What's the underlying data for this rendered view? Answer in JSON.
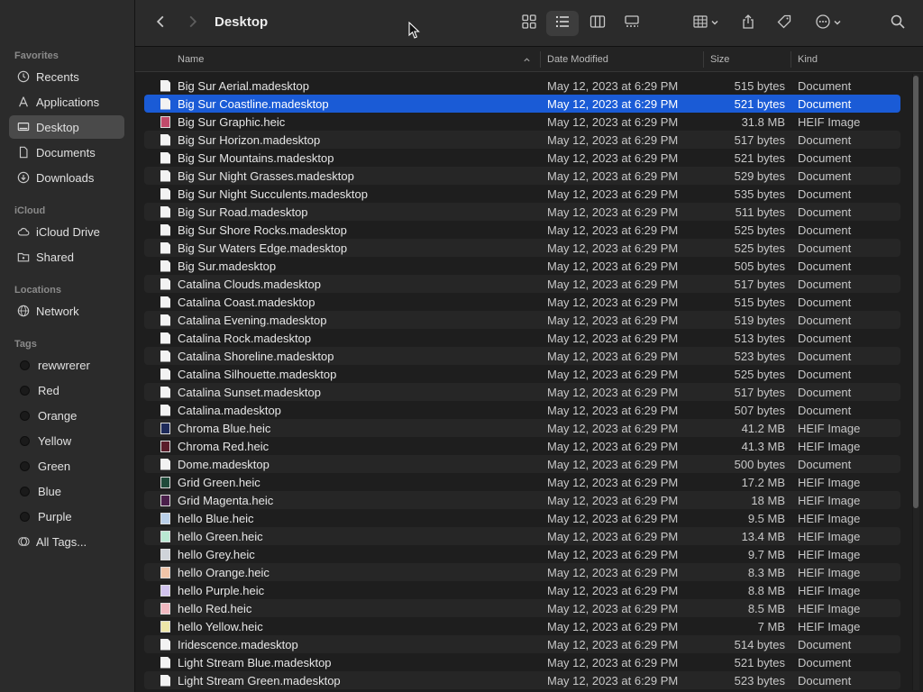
{
  "window": {
    "title": "Desktop"
  },
  "sidebar": {
    "sections": {
      "favorites": "Favorites",
      "icloud": "iCloud",
      "locations": "Locations",
      "tags": "Tags"
    },
    "favorites": [
      {
        "label": "Recents",
        "icon": "clock-icon"
      },
      {
        "label": "Applications",
        "icon": "applications-icon"
      },
      {
        "label": "Desktop",
        "icon": "desktop-icon",
        "active": true
      },
      {
        "label": "Documents",
        "icon": "document-icon"
      },
      {
        "label": "Downloads",
        "icon": "download-icon"
      }
    ],
    "icloud": [
      {
        "label": "iCloud Drive",
        "icon": "cloud-icon"
      },
      {
        "label": "Shared",
        "icon": "shared-folder-icon"
      }
    ],
    "locations": [
      {
        "label": "Network",
        "icon": "globe-icon"
      }
    ],
    "tags": [
      {
        "label": "rewwrerer"
      },
      {
        "label": "Red"
      },
      {
        "label": "Orange"
      },
      {
        "label": "Yellow"
      },
      {
        "label": "Green"
      },
      {
        "label": "Blue"
      },
      {
        "label": "Purple"
      },
      {
        "label": "All Tags...",
        "icon": "all-tags-icon"
      }
    ]
  },
  "columns": {
    "name": "Name",
    "date": "Date Modified",
    "size": "Size",
    "kind": "Kind"
  },
  "files": [
    {
      "name": "Big Sur Aerial.madesktop",
      "date": "May 12, 2023 at 6:29 PM",
      "size": "515 bytes",
      "kind": "Document",
      "type": "doc"
    },
    {
      "name": "Big Sur Coastline.madesktop",
      "date": "May 12, 2023 at 6:29 PM",
      "size": "521 bytes",
      "kind": "Document",
      "type": "doc",
      "selected": true
    },
    {
      "name": "Big Sur Graphic.heic",
      "date": "May 12, 2023 at 6:29 PM",
      "size": "31.8 MB",
      "kind": "HEIF Image",
      "type": "img",
      "thumb": "#c04a6a"
    },
    {
      "name": "Big Sur Horizon.madesktop",
      "date": "May 12, 2023 at 6:29 PM",
      "size": "517 bytes",
      "kind": "Document",
      "type": "doc"
    },
    {
      "name": "Big Sur Mountains.madesktop",
      "date": "May 12, 2023 at 6:29 PM",
      "size": "521 bytes",
      "kind": "Document",
      "type": "doc"
    },
    {
      "name": "Big Sur Night Grasses.madesktop",
      "date": "May 12, 2023 at 6:29 PM",
      "size": "529 bytes",
      "kind": "Document",
      "type": "doc"
    },
    {
      "name": "Big Sur Night Succulents.madesktop",
      "date": "May 12, 2023 at 6:29 PM",
      "size": "535 bytes",
      "kind": "Document",
      "type": "doc"
    },
    {
      "name": "Big Sur Road.madesktop",
      "date": "May 12, 2023 at 6:29 PM",
      "size": "511 bytes",
      "kind": "Document",
      "type": "doc"
    },
    {
      "name": "Big Sur Shore Rocks.madesktop",
      "date": "May 12, 2023 at 6:29 PM",
      "size": "525 bytes",
      "kind": "Document",
      "type": "doc"
    },
    {
      "name": "Big Sur Waters Edge.madesktop",
      "date": "May 12, 2023 at 6:29 PM",
      "size": "525 bytes",
      "kind": "Document",
      "type": "doc"
    },
    {
      "name": "Big Sur.madesktop",
      "date": "May 12, 2023 at 6:29 PM",
      "size": "505 bytes",
      "kind": "Document",
      "type": "doc"
    },
    {
      "name": "Catalina Clouds.madesktop",
      "date": "May 12, 2023 at 6:29 PM",
      "size": "517 bytes",
      "kind": "Document",
      "type": "doc"
    },
    {
      "name": "Catalina Coast.madesktop",
      "date": "May 12, 2023 at 6:29 PM",
      "size": "515 bytes",
      "kind": "Document",
      "type": "doc"
    },
    {
      "name": "Catalina Evening.madesktop",
      "date": "May 12, 2023 at 6:29 PM",
      "size": "519 bytes",
      "kind": "Document",
      "type": "doc"
    },
    {
      "name": "Catalina Rock.madesktop",
      "date": "May 12, 2023 at 6:29 PM",
      "size": "513 bytes",
      "kind": "Document",
      "type": "doc"
    },
    {
      "name": "Catalina Shoreline.madesktop",
      "date": "May 12, 2023 at 6:29 PM",
      "size": "523 bytes",
      "kind": "Document",
      "type": "doc"
    },
    {
      "name": "Catalina Silhouette.madesktop",
      "date": "May 12, 2023 at 6:29 PM",
      "size": "525 bytes",
      "kind": "Document",
      "type": "doc"
    },
    {
      "name": "Catalina Sunset.madesktop",
      "date": "May 12, 2023 at 6:29 PM",
      "size": "517 bytes",
      "kind": "Document",
      "type": "doc"
    },
    {
      "name": "Catalina.madesktop",
      "date": "May 12, 2023 at 6:29 PM",
      "size": "507 bytes",
      "kind": "Document",
      "type": "doc"
    },
    {
      "name": "Chroma Blue.heic",
      "date": "May 12, 2023 at 6:29 PM",
      "size": "41.2 MB",
      "kind": "HEIF Image",
      "type": "img",
      "thumb": "#1d2a5a"
    },
    {
      "name": "Chroma Red.heic",
      "date": "May 12, 2023 at 6:29 PM",
      "size": "41.3 MB",
      "kind": "HEIF Image",
      "type": "img",
      "thumb": "#5a1d2a"
    },
    {
      "name": "Dome.madesktop",
      "date": "May 12, 2023 at 6:29 PM",
      "size": "500 bytes",
      "kind": "Document",
      "type": "doc"
    },
    {
      "name": "Grid Green.heic",
      "date": "May 12, 2023 at 6:29 PM",
      "size": "17.2 MB",
      "kind": "HEIF Image",
      "type": "img",
      "thumb": "#1f4a3a"
    },
    {
      "name": "Grid Magenta.heic",
      "date": "May 12, 2023 at 6:29 PM",
      "size": "18 MB",
      "kind": "HEIF Image",
      "type": "img",
      "thumb": "#4a1f4a"
    },
    {
      "name": "hello Blue.heic",
      "date": "May 12, 2023 at 6:29 PM",
      "size": "9.5 MB",
      "kind": "HEIF Image",
      "type": "img",
      "thumb": "#b9cfe8"
    },
    {
      "name": "hello Green.heic",
      "date": "May 12, 2023 at 6:29 PM",
      "size": "13.4 MB",
      "kind": "HEIF Image",
      "type": "img",
      "thumb": "#b9e8d2"
    },
    {
      "name": "hello Grey.heic",
      "date": "May 12, 2023 at 6:29 PM",
      "size": "9.7 MB",
      "kind": "HEIF Image",
      "type": "img",
      "thumb": "#d0d4da"
    },
    {
      "name": "hello Orange.heic",
      "date": "May 12, 2023 at 6:29 PM",
      "size": "8.3 MB",
      "kind": "HEIF Image",
      "type": "img",
      "thumb": "#f0c4a8"
    },
    {
      "name": "hello Purple.heic",
      "date": "May 12, 2023 at 6:29 PM",
      "size": "8.8 MB",
      "kind": "HEIF Image",
      "type": "img",
      "thumb": "#d2c4ee"
    },
    {
      "name": "hello Red.heic",
      "date": "May 12, 2023 at 6:29 PM",
      "size": "8.5 MB",
      "kind": "HEIF Image",
      "type": "img",
      "thumb": "#f0b8c0"
    },
    {
      "name": "hello Yellow.heic",
      "date": "May 12, 2023 at 6:29 PM",
      "size": "7 MB",
      "kind": "HEIF Image",
      "type": "img",
      "thumb": "#eee6a8"
    },
    {
      "name": "Iridescence.madesktop",
      "date": "May 12, 2023 at 6:29 PM",
      "size": "514 bytes",
      "kind": "Document",
      "type": "doc"
    },
    {
      "name": "Light Stream Blue.madesktop",
      "date": "May 12, 2023 at 6:29 PM",
      "size": "521 bytes",
      "kind": "Document",
      "type": "doc"
    },
    {
      "name": "Light Stream Green.madesktop",
      "date": "May 12, 2023 at 6:29 PM",
      "size": "523 bytes",
      "kind": "Document",
      "type": "doc"
    }
  ],
  "colors": {
    "selection": "#1a5bd6",
    "sidebar_bg": "#2b2b2b",
    "content_bg": "#1e1e1e"
  }
}
